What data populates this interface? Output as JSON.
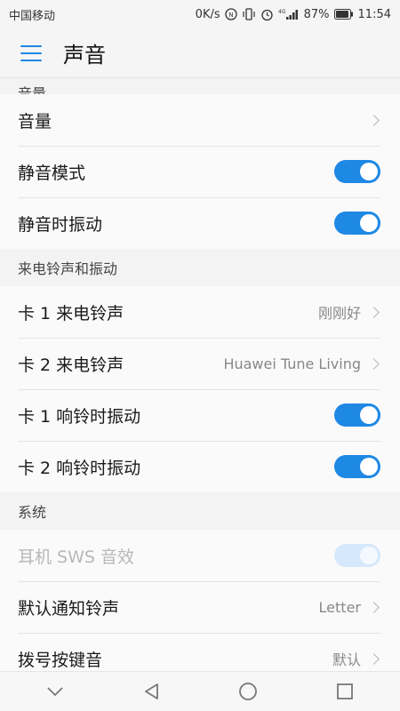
{
  "status_bar": {
    "carrier": "中国移动",
    "speed": "0K/s",
    "network": "4G",
    "battery": "87%",
    "time": "11:54",
    "icons": [
      "nfc-icon",
      "vibrate-icon",
      "alarm-icon",
      "signal-icon",
      "battery-icon"
    ]
  },
  "header": {
    "title": "声音",
    "menu_icon": "hamburger-menu-icon"
  },
  "accent_color": "#1e88e5",
  "sections": {
    "volume": {
      "header": "音量",
      "rows": [
        {
          "label": "音量",
          "type": "chevron"
        },
        {
          "label": "静音模式",
          "type": "toggle",
          "on": true
        },
        {
          "label": "静音时振动",
          "type": "toggle",
          "on": true
        }
      ]
    },
    "ringtone": {
      "header": "来电铃声和振动",
      "rows": [
        {
          "label": "卡 1 来电铃声",
          "value": "刚刚好",
          "type": "chevron"
        },
        {
          "label": "卡 2 来电铃声",
          "value": "Huawei Tune Living",
          "type": "chevron"
        },
        {
          "label": "卡 1 响铃时振动",
          "type": "toggle",
          "on": true
        },
        {
          "label": "卡 2 响铃时振动",
          "type": "toggle",
          "on": true
        }
      ]
    },
    "system": {
      "header": "系统",
      "rows": [
        {
          "label": "耳机 SWS 音效",
          "type": "toggle",
          "on": true,
          "disabled": true
        },
        {
          "label": "默认通知铃声",
          "value": "Letter",
          "type": "chevron"
        },
        {
          "label": "拨号按键音",
          "value": "默认",
          "type": "chevron"
        }
      ]
    }
  },
  "nav_bar": {
    "buttons": [
      "chevron-down-icon",
      "back-triangle-icon",
      "home-circle-icon",
      "recents-square-icon"
    ]
  }
}
